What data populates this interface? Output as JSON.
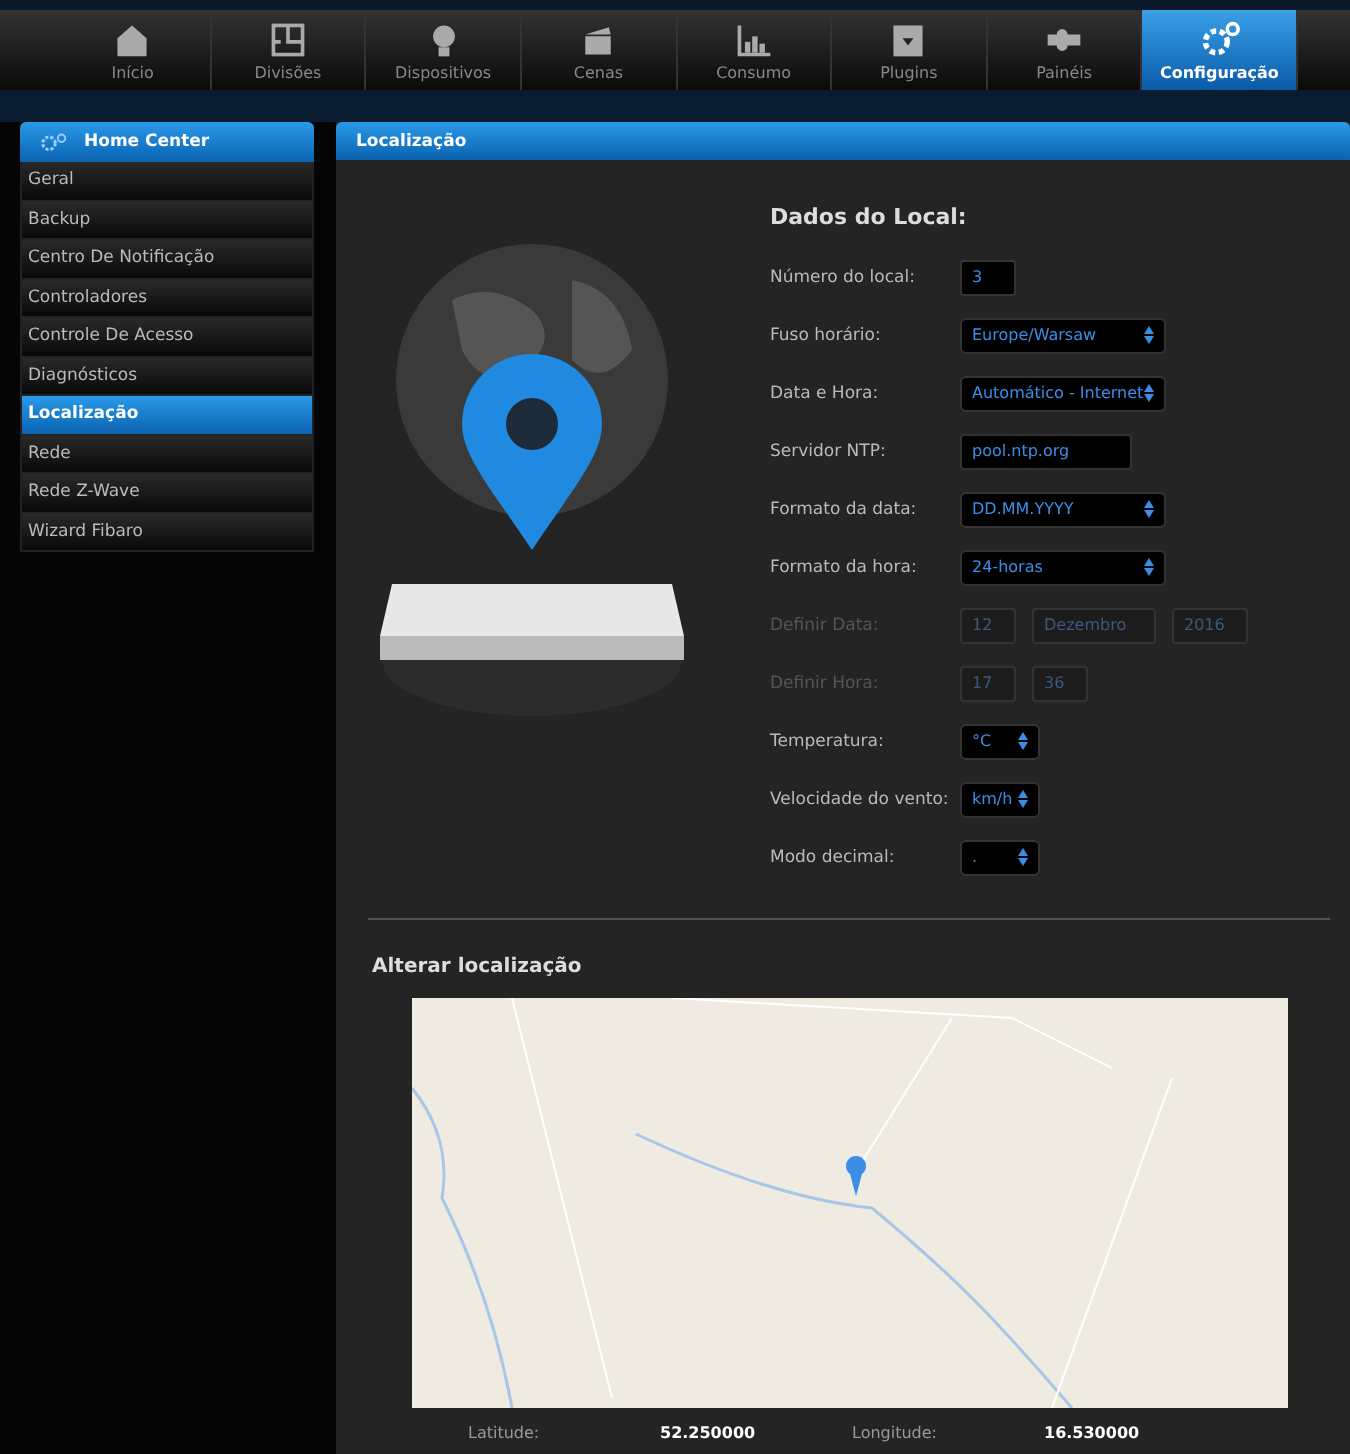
{
  "nav": {
    "items": [
      {
        "kind": "home",
        "label": "Início",
        "selected": false
      },
      {
        "kind": "rooms",
        "label": "Divisões",
        "selected": false
      },
      {
        "kind": "bulb",
        "label": "Dispositivos",
        "selected": false
      },
      {
        "kind": "scene",
        "label": "Cenas",
        "selected": false
      },
      {
        "kind": "chart",
        "label": "Consumo",
        "selected": false
      },
      {
        "kind": "box",
        "label": "Plugins",
        "selected": false
      },
      {
        "kind": "puzzle",
        "label": "Painéis",
        "selected": false
      },
      {
        "kind": "gears",
        "label": "Configuração",
        "selected": true
      }
    ]
  },
  "sidebar": {
    "header": "Home Center",
    "items": [
      {
        "label": "Geral",
        "selected": false
      },
      {
        "label": "Backup",
        "selected": false
      },
      {
        "label": "Centro De Notificação",
        "selected": false
      },
      {
        "label": "Controladores",
        "selected": false
      },
      {
        "label": "Controle De Acesso",
        "selected": false
      },
      {
        "label": "Diagnósticos",
        "selected": false
      },
      {
        "label": "Localização",
        "selected": true
      },
      {
        "label": "Rede",
        "selected": false
      },
      {
        "label": "Rede Z-Wave",
        "selected": false
      },
      {
        "label": "Wizard Fibaro",
        "selected": false
      }
    ]
  },
  "panel": {
    "title": "Localização"
  },
  "form": {
    "title": "Dados do Local:",
    "rows": [
      {
        "kind": "text",
        "label": "Número do local:",
        "disabled": false,
        "values": [
          "3"
        ]
      },
      {
        "kind": "select",
        "label": "Fuso horário:",
        "disabled": false,
        "values": [
          "Europe/Warsaw"
        ]
      },
      {
        "kind": "select",
        "label": "Data e Hora:",
        "disabled": false,
        "values": [
          "Automático - Internet"
        ]
      },
      {
        "kind": "text",
        "label": "Servidor NTP:",
        "disabled": false,
        "values": [
          "pool.ntp.org"
        ]
      },
      {
        "kind": "select",
        "label": "Formato da data:",
        "disabled": false,
        "values": [
          "DD.MM.YYYY"
        ]
      },
      {
        "kind": "select",
        "label": "Formato da hora:",
        "disabled": false,
        "values": [
          "24-horas"
        ]
      },
      {
        "kind": "text",
        "label": "Definir Data:",
        "disabled": true,
        "values": [
          "12",
          "Dezembro",
          "2016"
        ]
      },
      {
        "kind": "text",
        "label": "Definir Hora:",
        "disabled": true,
        "values": [
          "17",
          "36"
        ]
      },
      {
        "kind": "select",
        "label": "Temperatura:",
        "disabled": false,
        "values": [
          "°C"
        ]
      },
      {
        "kind": "select",
        "label": "Velocidade do vento:",
        "disabled": false,
        "values": [
          "km/h"
        ]
      },
      {
        "kind": "select",
        "label": "Modo decimal:",
        "disabled": false,
        "values": [
          "."
        ]
      }
    ]
  },
  "location": {
    "title": "Alterar localização",
    "latitude_label": "Latitude:",
    "latitude": "52.250000",
    "longitude_label": "Longitude:",
    "longitude": "16.530000"
  }
}
